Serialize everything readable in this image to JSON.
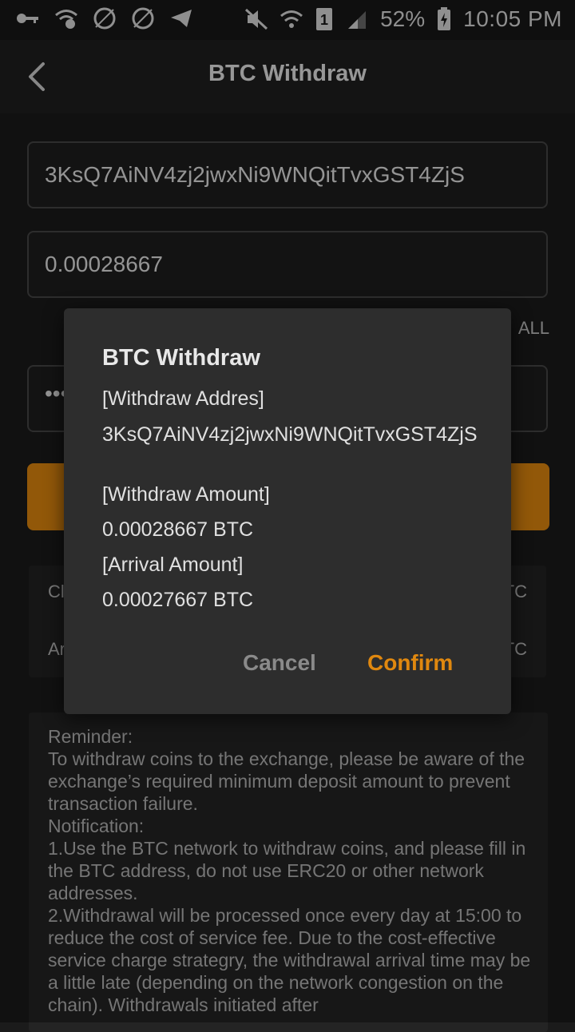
{
  "status_bar": {
    "battery": "52%",
    "time": "10:05 PM",
    "icons": [
      "key-icon",
      "wifi-question-icon",
      "ssh-icon",
      "rev-icon",
      "telegram-icon",
      "mute-icon",
      "wifi-icon",
      "sim-1-icon",
      "signal-icon",
      "battery-charging-icon"
    ],
    "sim_label": "1"
  },
  "header": {
    "title": "BTC Withdraw"
  },
  "form": {
    "address_value": "3KsQ7AiNV4zj2jwxNi9WNQitTvxGST4ZjS",
    "amount_value": "0.00028667",
    "all_label": "ALL",
    "password_mask": "•••"
  },
  "info": {
    "row1_left": "Cl",
    "row1_right": "TC",
    "row2_left": "Ar",
    "row2_right": "TC"
  },
  "reminder": {
    "text": "Reminder:\nTo withdraw coins to the exchange, please be aware of the exchange’s required minimum deposit amount to prevent transaction failure.\nNotification:\n1.Use the BTC network to withdraw coins, and please fill in the BTC address, do not use ERC20 or other network addresses.\n2.Withdrawal will be processed once every day at 15:00 to reduce the cost of service fee.  Due to the cost-effective service charge strategry, the withdrawal arrival time may be a little late (depending on the network congestion on the chain). Withdrawals initiated after"
  },
  "dialog": {
    "title": "BTC Withdraw",
    "address_label": "[Withdraw Addres]",
    "address_value": "3KsQ7AiNV4zj2jwxNi9WNQitTvxGST4ZjS",
    "amount_label": "[Withdraw Amount]",
    "amount_value": "0.00028667 BTC",
    "arrival_label": "[Arrival Amount]",
    "arrival_value": "0.00027667 BTC",
    "cancel_label": "Cancel",
    "confirm_label": "Confirm"
  },
  "colors": {
    "accent": "#e0880f",
    "background": "#1b1b1b",
    "dialog": "#2d2d2d"
  }
}
